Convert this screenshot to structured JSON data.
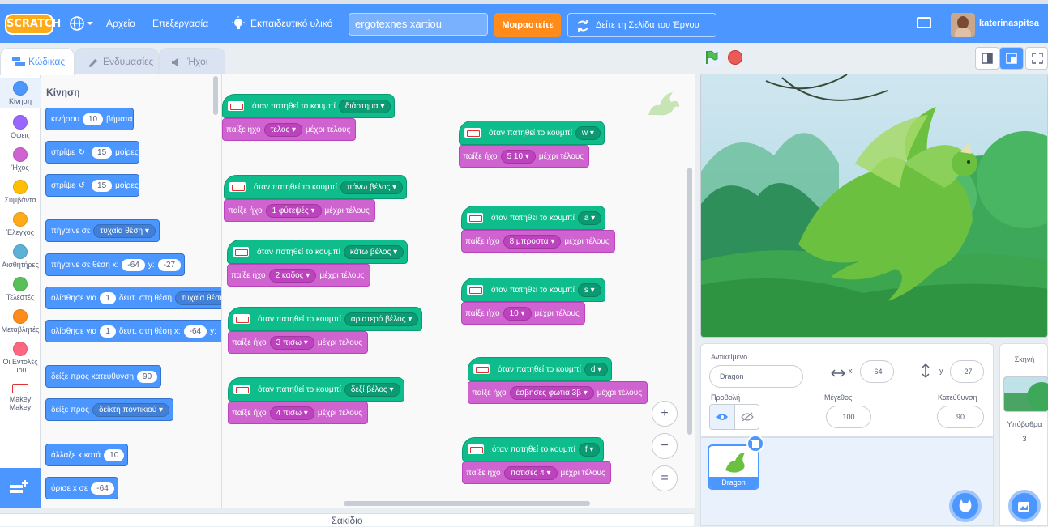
{
  "menu": {
    "logo": "SCRATCH",
    "file": "Αρχείο",
    "edit": "Επεξεργασία",
    "tutorials": "Εκπαιδευτικό υλικό",
    "project_title": "ergotexnes xartiou",
    "share": "Μοιραστείτε",
    "see_project_page": "Δείτε τη Σελίδα του Έργου",
    "username": "katerinaspitsa"
  },
  "tabs": {
    "code": "Κώδικας",
    "costumes": "Ενδυμασίες",
    "sounds": "Ήχοι"
  },
  "categories": [
    {
      "label": "Κίνηση",
      "color": "#4c97ff"
    },
    {
      "label": "Όψεις",
      "color": "#9966ff"
    },
    {
      "label": "Ήχος",
      "color": "#cf63cf"
    },
    {
      "label": "Συμβάντα",
      "color": "#ffbf00"
    },
    {
      "label": "Έλεγχος",
      "color": "#ffab19"
    },
    {
      "label": "Αισθητήρες",
      "color": "#5cb1d6"
    },
    {
      "label": "Τελεστές",
      "color": "#59c059"
    },
    {
      "label": "Μεταβλητές",
      "color": "#ff8c1a"
    },
    {
      "label": "Οι Εντολές μου",
      "color": "#ff6680"
    },
    {
      "label": "Makey Makey",
      "color": "#ffffff"
    }
  ],
  "palette": {
    "heading": "Κίνηση",
    "move": {
      "a": "κινήσου",
      "steps": "10",
      "b": "βήματα"
    },
    "turn_right": {
      "a": "στρίψε",
      "deg": "15",
      "b": "μοίρες"
    },
    "turn_left": {
      "a": "στρίψε",
      "deg": "15",
      "b": "μοίρες"
    },
    "goto": {
      "a": "πήγαινε σε",
      "target": "τυχαία θέση"
    },
    "goto_xy": {
      "a": "πήγαινε σε θέση x:",
      "x": "-64",
      "b": "y:",
      "y": "-27"
    },
    "glide": {
      "a": "ολίσθησε για",
      "secs": "1",
      "b": "δευτ. στη θέση",
      "target": "τυχαία θέση"
    },
    "glide_xy": {
      "a": "ολίσθησε για",
      "secs": "1",
      "b": "δευτ. στη θέση x:",
      "x": "-64",
      "c": "y:"
    },
    "point_dir": {
      "a": "δείξε προς κατεύθυνση",
      "dir": "90"
    },
    "point_towards": {
      "a": "δείξε προς",
      "target": "δείκτη ποντικιού"
    },
    "change_x": {
      "a": "άλλαξε x κατά",
      "v": "10"
    },
    "set_x": {
      "a": "όρισε x σε",
      "v": "-64"
    }
  },
  "scripts": [
    {
      "when": "όταν πατηθεί το κουμπί",
      "key": "διάστημα",
      "play": "παίξε ήχο",
      "sound": "τελος",
      "until": "μέχρι τέλους"
    },
    {
      "when": "όταν πατηθεί το κουμπί",
      "key": "πάνω βέλος",
      "play": "παίξε ήχο",
      "sound": "1 φύτεψές",
      "until": "μέχρι τέλους"
    },
    {
      "when": "όταν πατηθεί το κουμπί",
      "key": "κάτω βέλος",
      "play": "παίξε ήχο",
      "sound": "2 καδος",
      "until": "μέχρι τέλους"
    },
    {
      "when": "όταν πατηθεί το κουμπί",
      "key": "αριστερό βέλος",
      "play": "παίξε ήχο",
      "sound": "3 πισω",
      "until": "μέχρι τέλους"
    },
    {
      "when": "όταν πατηθεί το κουμπί",
      "key": "δεξί βέλος",
      "play": "παίξε ήχο",
      "sound": "4 πισω",
      "until": "μέχρι τέλους"
    },
    {
      "when": "όταν πατηθεί το κουμπί",
      "key": "w",
      "play": "παίξε ήχο",
      "sound": "5 10",
      "until": "μέχρι τέλους"
    },
    {
      "when": "όταν πατηθεί το κουμπί",
      "key": "a",
      "play": "παίξε ήχο",
      "sound": "8 μπροστα",
      "until": "μέχρι τέλους"
    },
    {
      "when": "όταν πατηθεί το κουμπί",
      "key": "s",
      "play": "παίξε ήχο",
      "sound": "10",
      "until": "μέχρι τέλους"
    },
    {
      "when": "όταν πατηθεί το κουμπί",
      "key": "d",
      "play": "παίξε ήχο",
      "sound": "έσβησες φωτιά 3β",
      "until": "μέχρι τέλους"
    },
    {
      "when": "όταν πατηθεί το κουμπί",
      "key": "f",
      "play": "παίξε ήχο",
      "sound": "ποτισες 4",
      "until": "μέχρι τέλους"
    }
  ],
  "zoom": {
    "in": "+",
    "out": "−",
    "reset": "="
  },
  "backpack": "Σακίδιο",
  "sprite_info": {
    "sprite_label": "Αντικείμενο",
    "sprite_name": "Dragon",
    "x_label": "x",
    "x": "-64",
    "y_label": "y",
    "y": "-27",
    "show_label": "Προβολή",
    "size_label": "Μέγεθος",
    "size": "100",
    "direction_label": "Κατεύθυνση",
    "direction": "90"
  },
  "sprite_list": {
    "sprite": "Dragon"
  },
  "stage_panel": {
    "title": "Σκηνή",
    "backdrops_label": "Υπόβαθρα",
    "backdrops_count": "3"
  }
}
